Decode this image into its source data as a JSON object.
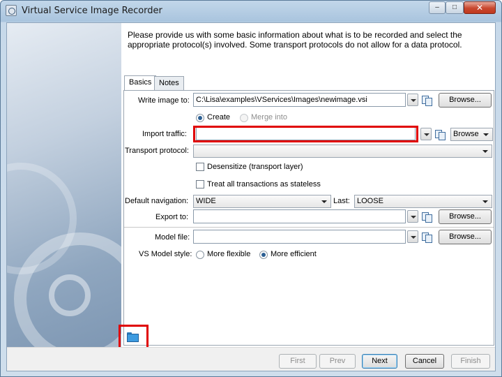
{
  "window": {
    "title": "Virtual Service Image Recorder",
    "controls": {
      "minimize": "–",
      "maximize": "□",
      "close": "✕"
    }
  },
  "intro_text": "Please provide us with some basic information about what is to be recorded and select the appropriate protocol(s) involved.  Some transport protocols do not allow for a data protocol.",
  "tabs": [
    {
      "label": "Basics",
      "active": true
    },
    {
      "label": "Notes",
      "active": false
    }
  ],
  "form": {
    "write_image": {
      "label": "Write image to:",
      "value": "C:\\Lisa\\examples\\VServices\\Images\\newimage.vsi",
      "browse": "Browse..."
    },
    "mode": {
      "create": "Create",
      "merge": "Merge into",
      "selected": "create"
    },
    "import_traffic": {
      "label": "Import traffic:",
      "value": "",
      "browse": "Browse"
    },
    "transport_protocol": {
      "label": "Transport protocol:",
      "value": ""
    },
    "desensitize": {
      "label": "Desensitize (transport layer)",
      "checked": false
    },
    "stateless": {
      "label": "Treat all transactions as stateless",
      "checked": false
    },
    "default_navigation": {
      "label": "Default navigation:",
      "value": "WIDE"
    },
    "last": {
      "label": "Last:",
      "value": "LOOSE"
    },
    "export_to": {
      "label": "Export to:",
      "value": "",
      "browse": "Browse..."
    },
    "model_file": {
      "label": "Model file:",
      "value": "",
      "browse": "Browse..."
    },
    "vs_model_style": {
      "label": "VS Model style:",
      "flexible": "More flexible",
      "efficient": "More efficient",
      "selected": "efficient"
    }
  },
  "footer": {
    "first": "First",
    "prev": "Prev",
    "next": "Next",
    "cancel": "Cancel",
    "finish": "Finish"
  },
  "colors": {
    "highlight": "#e00000",
    "titlebar": "#b9cfe4"
  }
}
